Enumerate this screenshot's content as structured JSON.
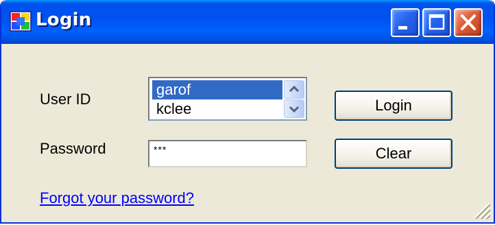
{
  "window": {
    "title": "Login",
    "icon": "app-windows-icon"
  },
  "caption_buttons": {
    "minimize_icon": "minimize-icon",
    "maximize_icon": "maximize-icon",
    "close_icon": "close-icon"
  },
  "form": {
    "user_id_label": "User ID",
    "password_label": "Password",
    "user_list": {
      "items": [
        "garof",
        "kclee"
      ],
      "selected_index": 0
    },
    "password_value": "***"
  },
  "buttons": {
    "login_label": "Login",
    "clear_label": "Clear"
  },
  "links": {
    "forgot_password": "Forgot your password?"
  },
  "colors": {
    "title_bar": "#0054e3",
    "window_face": "#ece9d8",
    "selection": "#316ac5",
    "link": "#0000ff",
    "close_button": "#e0603b"
  }
}
